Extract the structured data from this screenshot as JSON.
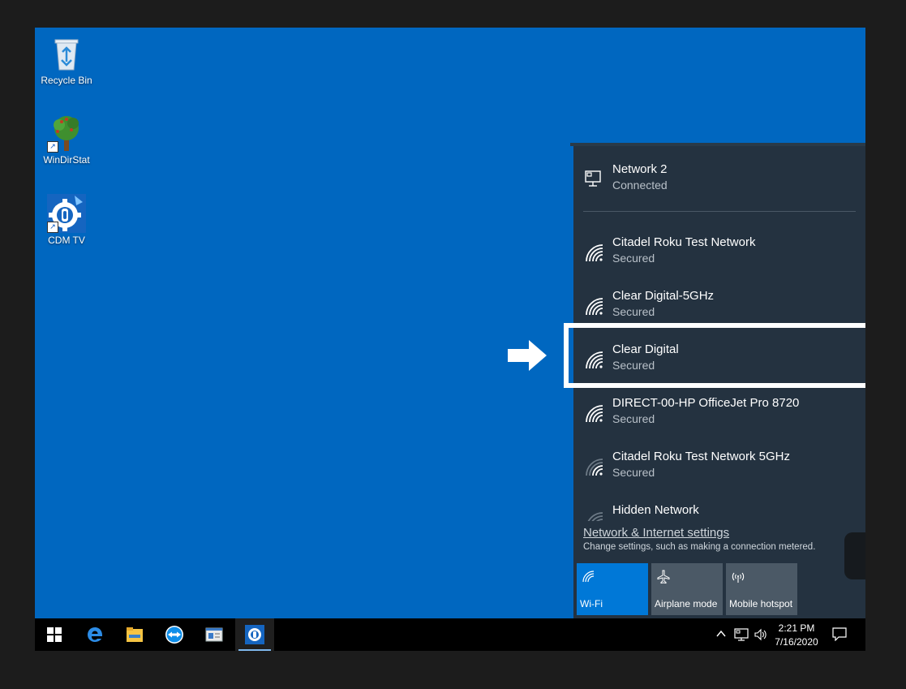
{
  "desktop": {
    "icons": [
      {
        "label": "Recycle Bin"
      },
      {
        "label": "WinDirStat"
      },
      {
        "label": "CDM TV"
      }
    ]
  },
  "flyout": {
    "connected": {
      "name": "Network  2",
      "status": "Connected"
    },
    "networks": [
      {
        "name": "Citadel Roku Test Network",
        "status": "Secured"
      },
      {
        "name": "Clear Digital-5GHz",
        "status": "Secured"
      },
      {
        "name": "Clear Digital",
        "status": "Secured"
      },
      {
        "name": "DIRECT-00-HP OfficeJet Pro 8720",
        "status": "Secured"
      },
      {
        "name": "Citadel Roku Test Network 5GHz",
        "status": "Secured"
      },
      {
        "name": "Hidden Network",
        "status": ""
      }
    ],
    "settings_link": "Network & Internet settings",
    "settings_desc": "Change settings, such as making a connection metered.",
    "quick_actions": [
      {
        "label": "Wi-Fi",
        "icon": "wifi-icon",
        "active": true
      },
      {
        "label": "Airplane mode",
        "icon": "airplane-icon",
        "active": false
      },
      {
        "label": "Mobile hotspot",
        "icon": "hotspot-icon",
        "active": false
      }
    ]
  },
  "taskbar": {
    "time": "2:21 PM",
    "date": "7/16/2020"
  },
  "colors": {
    "desktop": "#0067c0",
    "flyout": "#243240",
    "accent": "#0078d7"
  }
}
